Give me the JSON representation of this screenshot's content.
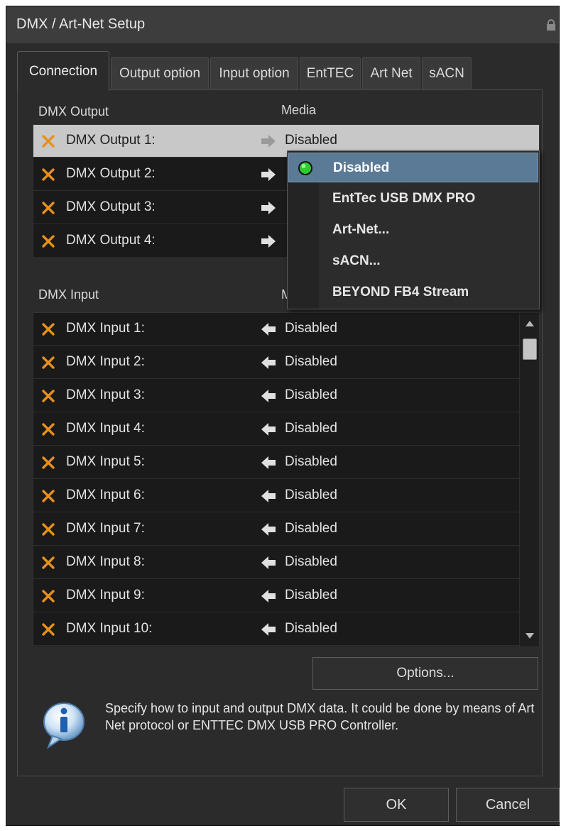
{
  "window": {
    "title": "DMX / Art-Net Setup"
  },
  "tabs": [
    {
      "label": "Connection",
      "active": true
    },
    {
      "label": "Output option",
      "active": false
    },
    {
      "label": "Input option",
      "active": false
    },
    {
      "label": "EntTEC",
      "active": false
    },
    {
      "label": "Art Net",
      "active": false
    },
    {
      "label": "sACN",
      "active": false
    }
  ],
  "output_section": {
    "title": "DMX Output",
    "media_header": "Media",
    "rows": [
      {
        "label": "DMX Output 1:",
        "media": "Disabled",
        "selected": true
      },
      {
        "label": "DMX Output 2:",
        "media": "",
        "selected": false
      },
      {
        "label": "DMX Output 3:",
        "media": "",
        "selected": false
      },
      {
        "label": "DMX Output 4:",
        "media": "",
        "selected": false
      }
    ]
  },
  "input_section": {
    "title": "DMX Input",
    "media_header_partial": "M",
    "rows": [
      {
        "label": "DMX Input 1:",
        "media": "Disabled"
      },
      {
        "label": "DMX Input 2:",
        "media": "Disabled"
      },
      {
        "label": "DMX Input 3:",
        "media": "Disabled"
      },
      {
        "label": "DMX Input 4:",
        "media": "Disabled"
      },
      {
        "label": "DMX Input 5:",
        "media": "Disabled"
      },
      {
        "label": "DMX Input 6:",
        "media": "Disabled"
      },
      {
        "label": "DMX Input 7:",
        "media": "Disabled"
      },
      {
        "label": "DMX Input 8:",
        "media": "Disabled"
      },
      {
        "label": "DMX Input 9:",
        "media": "Disabled"
      },
      {
        "label": "DMX Input 10:",
        "media": "Disabled"
      }
    ]
  },
  "media_dropdown": {
    "items": [
      {
        "label": "Disabled",
        "checked": true,
        "highlighted": true
      },
      {
        "label": "EntTec USB DMX PRO",
        "checked": false,
        "highlighted": false
      },
      {
        "label": "Art-Net...",
        "checked": false,
        "highlighted": false
      },
      {
        "label": "sACN...",
        "checked": false,
        "highlighted": false
      },
      {
        "label": "BEYOND FB4 Stream",
        "checked": false,
        "highlighted": false
      }
    ]
  },
  "buttons": {
    "options": "Options...",
    "ok": "OK",
    "cancel": "Cancel"
  },
  "info": {
    "text": "Specify how to input and output DMX data. It could be done by means of Art Net protocol or ENTTEC DMX USB PRO Controller."
  },
  "icons": {
    "status": "x-icon",
    "output_arrow": "arrow-right-icon",
    "input_arrow": "arrow-left-icon",
    "info": "info-icon",
    "active_indicator": "green-dot-icon"
  },
  "colors": {
    "x_icon": "#e8901c",
    "highlight": "#5b7a96",
    "active_dot": "#2ecc2e"
  }
}
